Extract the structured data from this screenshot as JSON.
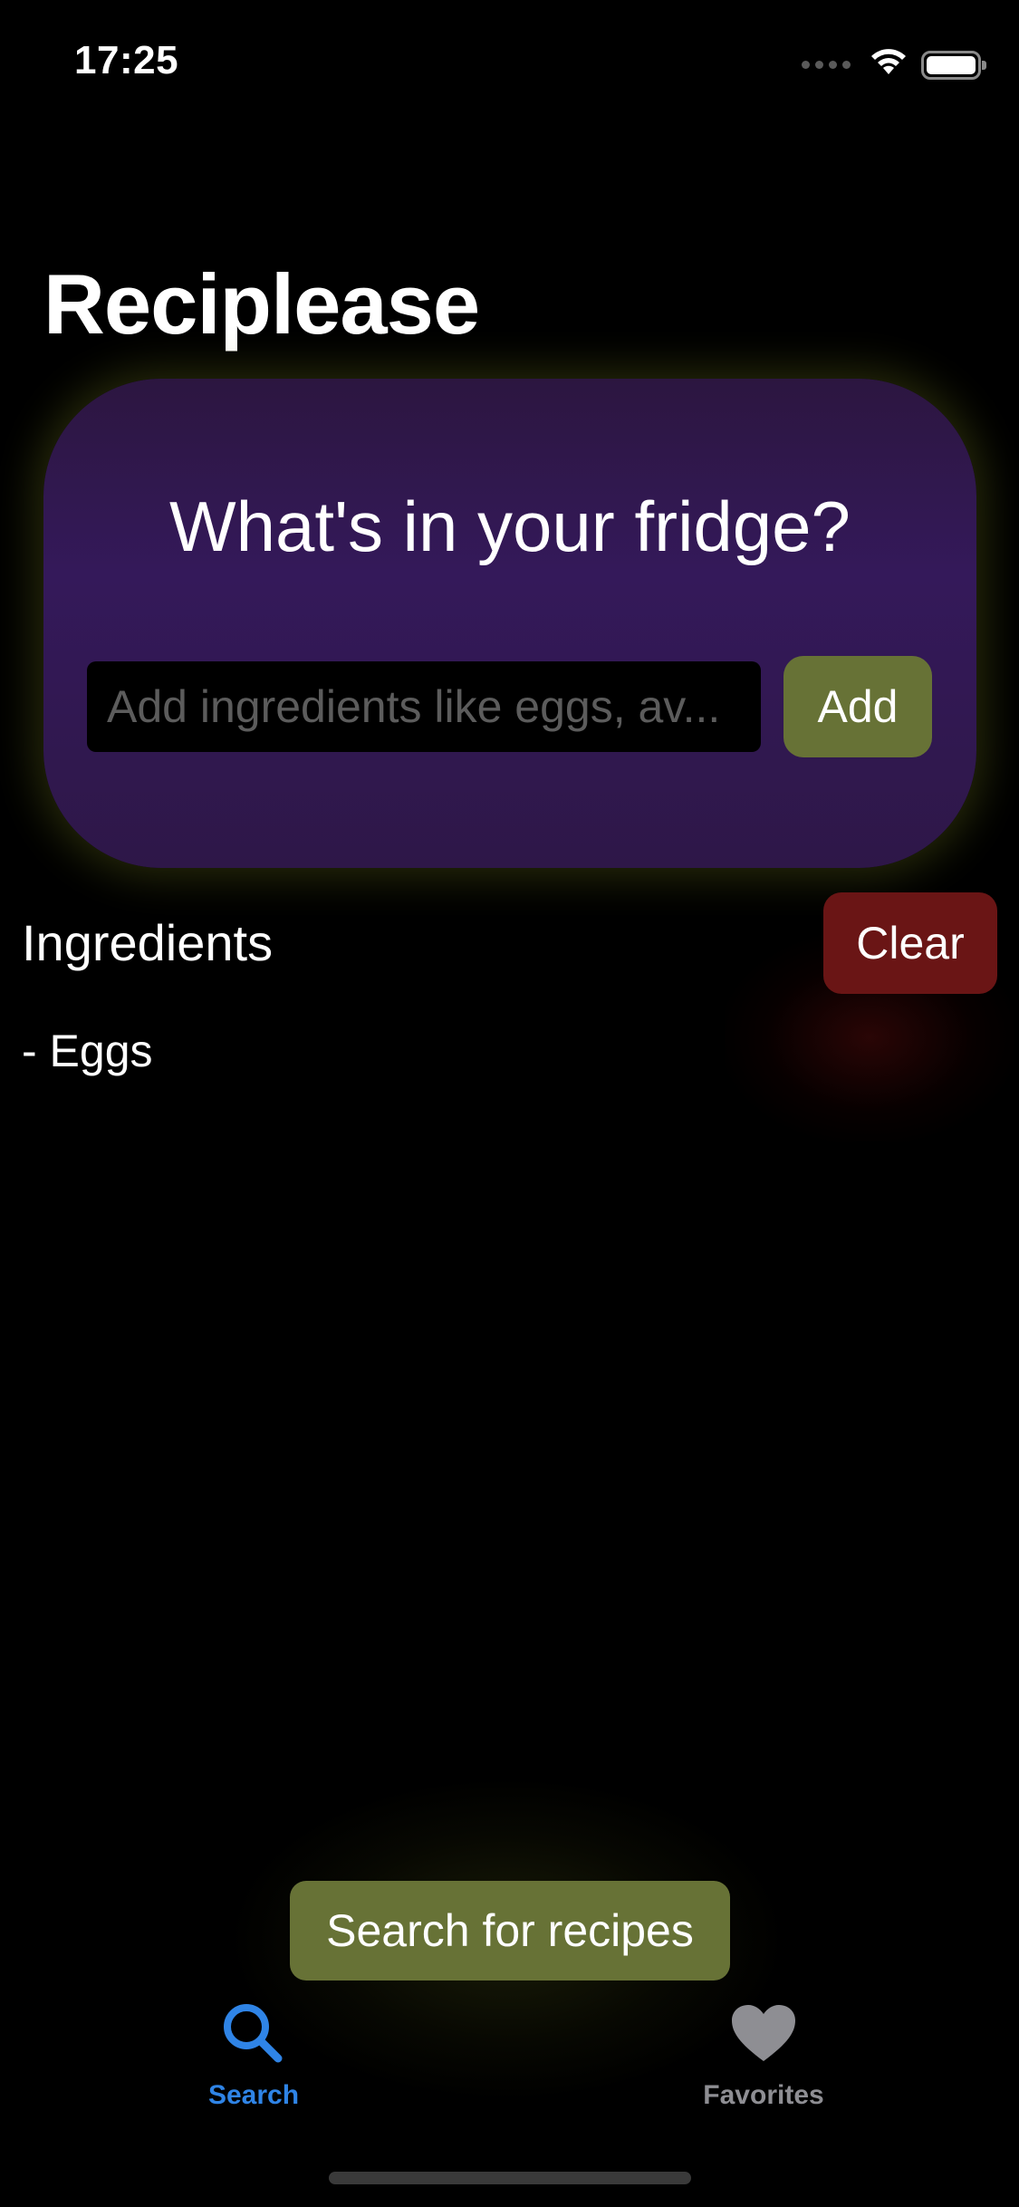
{
  "status_bar": {
    "time": "17:25",
    "battery_level": 1.0
  },
  "header": {
    "title": "Reciplease"
  },
  "fridge_card": {
    "heading": "What's in your fridge?",
    "input": {
      "value": "",
      "placeholder": "Add ingredients like eggs, av..."
    },
    "add_label": "Add"
  },
  "ingredients": {
    "heading": "Ingredients",
    "clear_label": "Clear",
    "items": [
      "- Eggs"
    ]
  },
  "search_button": {
    "label": "Search for recipes"
  },
  "tab_bar": {
    "tabs": [
      {
        "label": "Search",
        "icon": "search-icon",
        "selected": true
      },
      {
        "label": "Favorites",
        "icon": "heart-icon",
        "selected": false
      }
    ]
  },
  "colors": {
    "background": "#000000",
    "card": "#321a4e",
    "button_green": "#677236",
    "button_red": "#6a1515",
    "tab_active": "#2f84e6",
    "tab_inactive": "#8e8e93"
  }
}
